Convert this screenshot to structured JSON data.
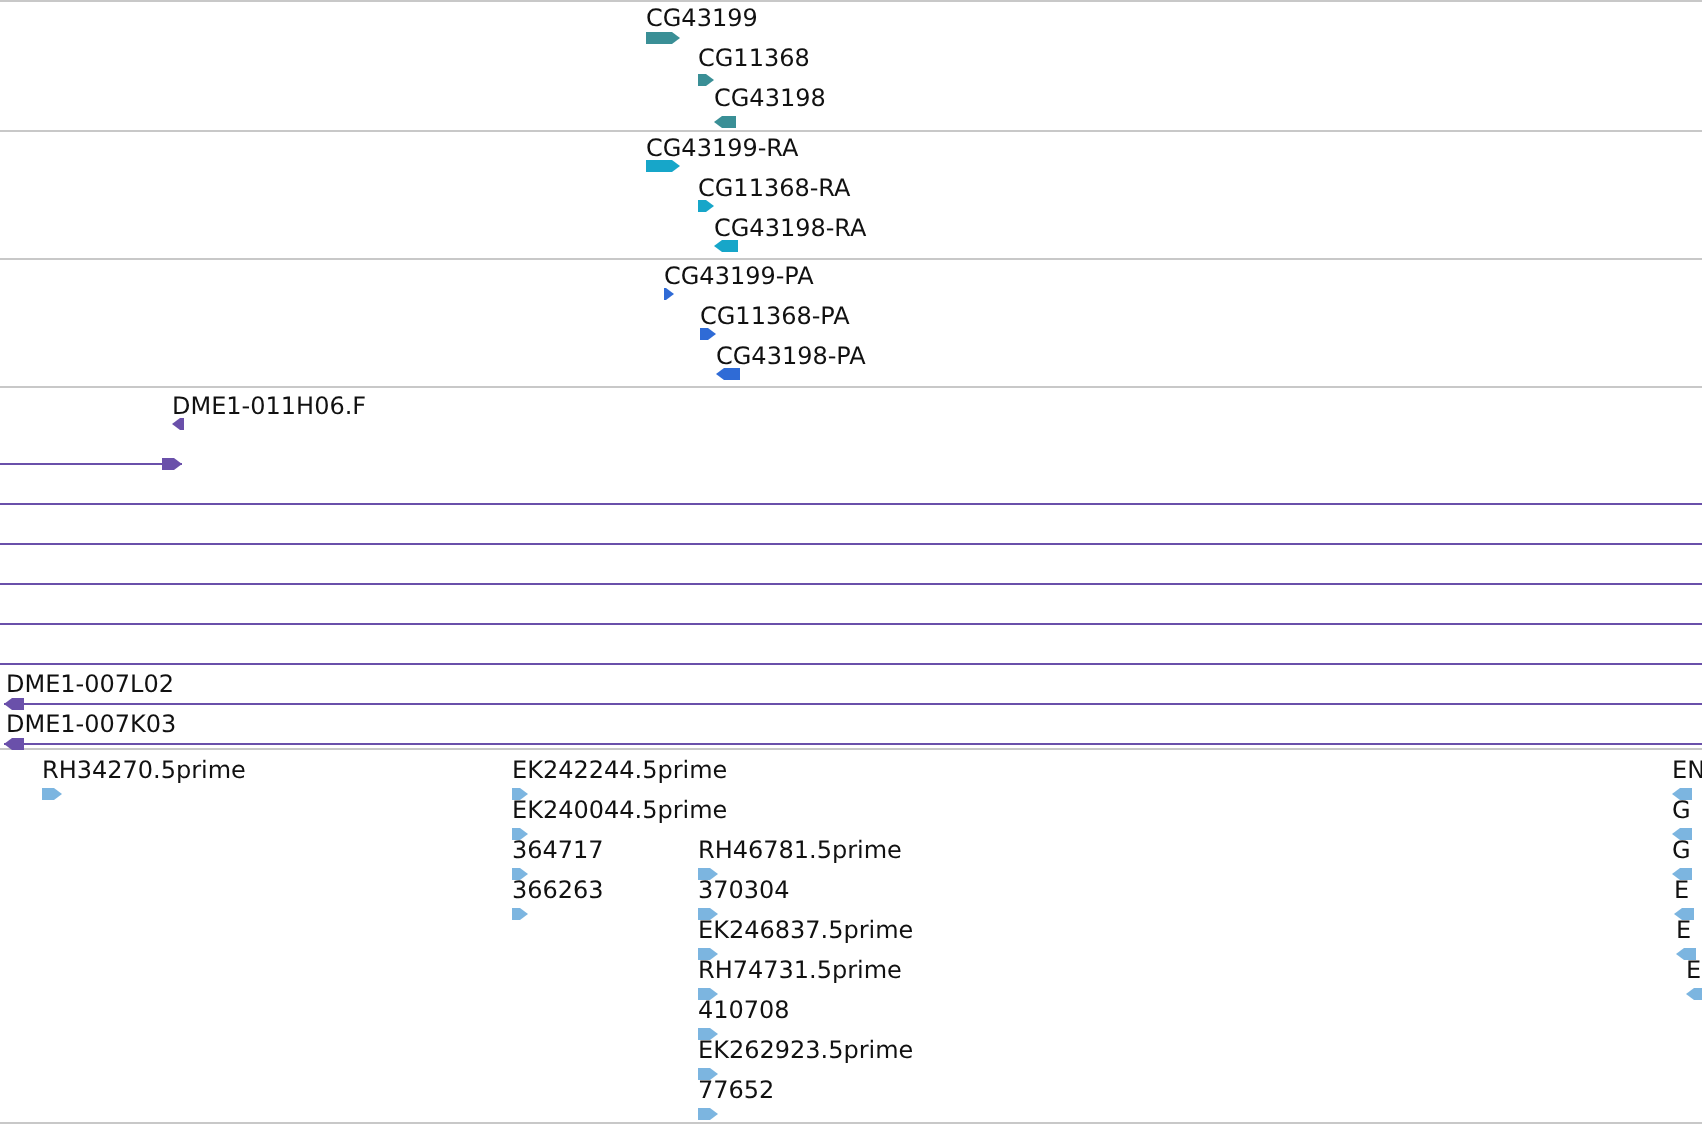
{
  "tracks": [
    {
      "color": "#3a8f96",
      "features": [
        {
          "kind": "gene",
          "label": "CG43199",
          "reverse": false
        },
        {
          "kind": "gene",
          "label": "CG11368",
          "reverse": false
        },
        {
          "kind": "gene",
          "label": "CG43198",
          "reverse": true
        }
      ]
    },
    {
      "color": "#17a6c9",
      "features": [
        {
          "kind": "gene",
          "label": "CG43199-RA",
          "reverse": false
        },
        {
          "kind": "gene",
          "label": "CG11368-RA",
          "reverse": false
        },
        {
          "kind": "gene",
          "label": "CG43198-RA",
          "reverse": true
        }
      ]
    },
    {
      "color": "#2f6bd6",
      "features": [
        {
          "kind": "gene",
          "label": "CG43199-PA",
          "reverse": false
        },
        {
          "kind": "gene",
          "label": "CG11368-PA",
          "reverse": false
        },
        {
          "kind": "gene",
          "label": "CG43198-PA",
          "reverse": true
        }
      ]
    },
    {
      "color": "#6a50aa",
      "features": [
        {
          "kind": "gene",
          "label": "DME1-011H06.F",
          "reverse": true
        },
        {
          "kind": "line",
          "head": true,
          "reverse": false
        },
        {
          "kind": "line",
          "head": false
        },
        {
          "kind": "line",
          "head": false
        },
        {
          "kind": "line",
          "head": false
        },
        {
          "kind": "line",
          "head": false
        },
        {
          "kind": "line",
          "head": false
        },
        {
          "kind": "line",
          "label": "DME1-007L02",
          "head": true,
          "reverse": true
        },
        {
          "kind": "line",
          "label": "DME1-007K03",
          "head": true,
          "reverse": true
        }
      ]
    },
    {
      "color": "#7cb5e0",
      "features": [
        {
          "kind": "gene",
          "label": "RH34270.5prime",
          "reverse": false
        },
        {
          "kind": "gene",
          "label": "EK242244.5prime",
          "reverse": false
        },
        {
          "kind": "gene",
          "label": "EK240044.5prime",
          "reverse": false
        },
        {
          "kind": "gene",
          "label": "364717",
          "reverse": false
        },
        {
          "kind": "gene",
          "label": "366263",
          "reverse": false
        },
        {
          "kind": "gene",
          "label": "RH46781.5prime",
          "reverse": false
        },
        {
          "kind": "gene",
          "label": "370304",
          "reverse": false
        },
        {
          "kind": "gene",
          "label": "EK246837.5prime",
          "reverse": false
        },
        {
          "kind": "gene",
          "label": "RH74731.5prime",
          "reverse": false
        },
        {
          "kind": "gene",
          "label": "410708",
          "reverse": false
        },
        {
          "kind": "gene",
          "label": "EK262923.5prime",
          "reverse": false
        },
        {
          "kind": "gene",
          "label": "77652",
          "reverse": false
        },
        {
          "kind": "gene",
          "label": "EN",
          "reverse": true
        },
        {
          "kind": "gene",
          "label": "G",
          "reverse": true
        },
        {
          "kind": "gene",
          "label": "G",
          "reverse": true
        },
        {
          "kind": "gene",
          "label": "E",
          "reverse": true
        },
        {
          "kind": "gene",
          "label": "E",
          "reverse": true
        },
        {
          "kind": "gene",
          "label": "E",
          "reverse": true
        }
      ]
    }
  ]
}
